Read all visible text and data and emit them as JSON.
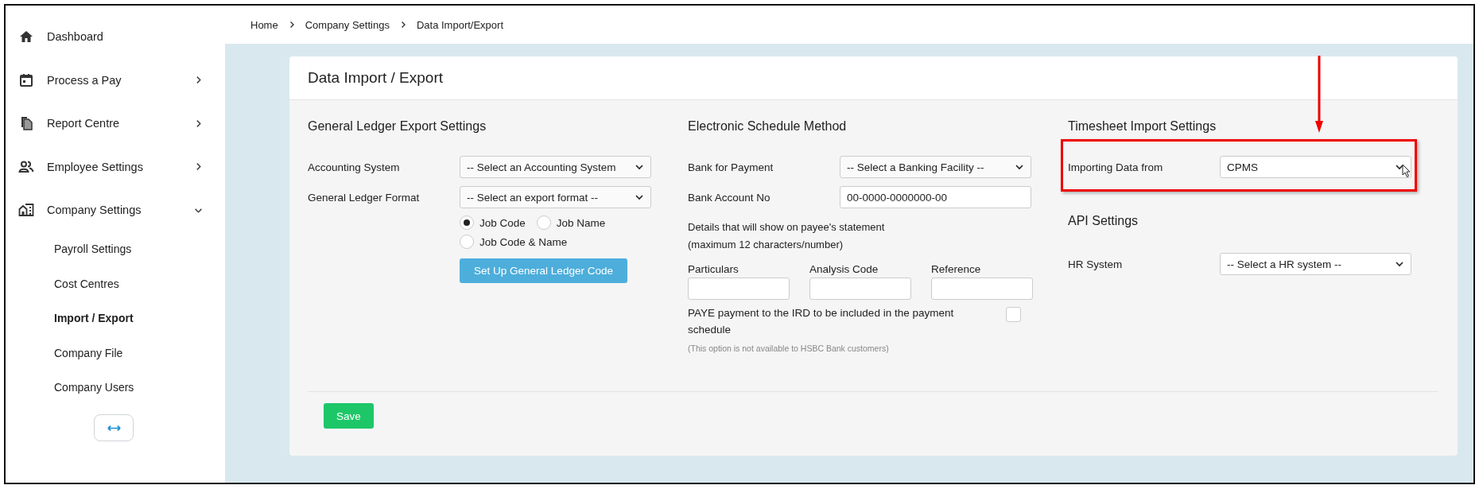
{
  "sidebar": {
    "items": [
      {
        "label": "Dashboard"
      },
      {
        "label": "Process a Pay",
        "expanded": false
      },
      {
        "label": "Report Centre",
        "expanded": false
      },
      {
        "label": "Employee Settings",
        "expanded": false
      },
      {
        "label": "Company Settings",
        "expanded": true,
        "children": [
          {
            "label": "Payroll Settings",
            "selected": false
          },
          {
            "label": "Cost Centres",
            "selected": false
          },
          {
            "label": "Import / Export",
            "selected": true
          },
          {
            "label": "Company File",
            "selected": false
          },
          {
            "label": "Company Users",
            "selected": false
          }
        ]
      }
    ]
  },
  "breadcrumb": [
    "Home",
    "Company Settings",
    "Data Import/Export"
  ],
  "card": {
    "title": "Data Import / Export",
    "general_ledger": {
      "heading": "General Ledger Export Settings",
      "fields": [
        {
          "label": "Accounting System",
          "placeholder": "-- Select an Accounting System"
        },
        {
          "label": "General Ledger Format",
          "placeholder": "-- Select an export format --"
        }
      ],
      "radios": [
        {
          "label": "Job Code",
          "selected": true
        },
        {
          "label": "Job Name",
          "selected": false
        },
        {
          "label": "Job Code & Name",
          "selected": false
        }
      ],
      "button": "Set Up General Ledger Code"
    },
    "electronic_schedule": {
      "heading": "Electronic Schedule Method",
      "fields": [
        {
          "label": "Bank for Payment",
          "kind": "select",
          "placeholder": "-- Select a Banking Facility --"
        },
        {
          "label": "Bank Account No",
          "kind": "input",
          "value": "00-0000-0000000-00"
        }
      ],
      "details_note": "Details that will show on payee's statement\n(maximum 12 characters/number)",
      "detail_fields": [
        {
          "label": "Particulars"
        },
        {
          "label": "Analysis Code"
        },
        {
          "label": "Reference"
        }
      ],
      "paye": {
        "label": "PAYE payment to the IRD to be included in the payment schedule",
        "checked": false
      },
      "hint": "(This option is not available to HSBC Bank customers)"
    },
    "timesheet": {
      "heading": "Timesheet Import Settings",
      "field": {
        "label": "Importing Data from",
        "value": "CPMS"
      }
    },
    "api": {
      "heading": "API Settings",
      "field": {
        "label": "HR System",
        "placeholder": "-- Select a HR system --"
      }
    },
    "save_button": "Save"
  }
}
